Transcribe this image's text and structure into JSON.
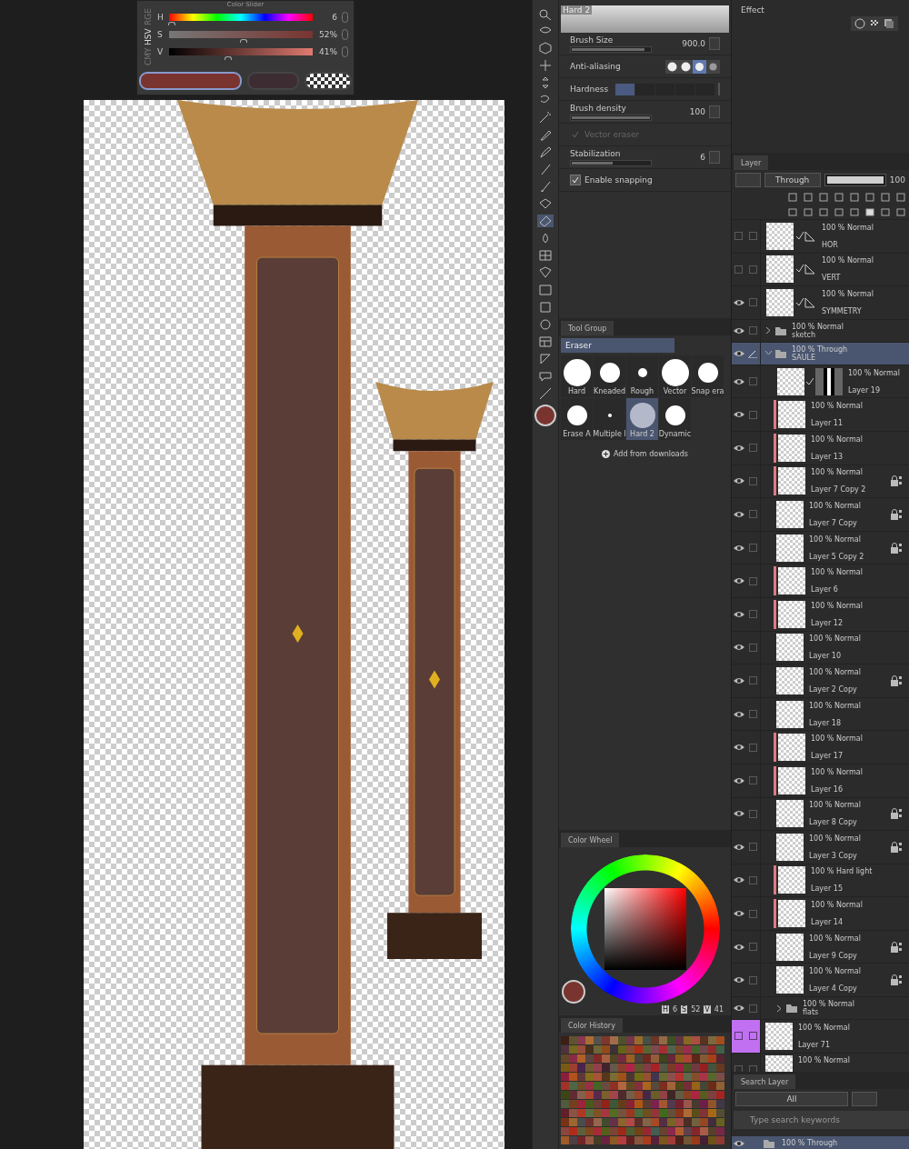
{
  "color_slider": {
    "title": "Color Slider",
    "modes": [
      {
        "label": "RGE",
        "selected": false
      },
      {
        "label": "HSV",
        "selected": true
      },
      {
        "label": "CMY",
        "selected": false
      }
    ],
    "channels": [
      {
        "label": "H",
        "kind": "hue",
        "level": 0.02,
        "reading": "6"
      },
      {
        "label": "S",
        "kind": "saturation",
        "level": 0.52,
        "reading": "52%"
      },
      {
        "label": "V",
        "kind": "value",
        "level": 0.41,
        "reading": "41%"
      }
    ],
    "swatches": [
      {
        "kind": "main",
        "color": "#7a3430",
        "selected": true
      },
      {
        "kind": "sub",
        "color": "#3e2c33",
        "selected": false
      },
      {
        "kind": "transparent",
        "selected": false
      }
    ]
  },
  "tool_settings": {
    "preset": "Hard 2",
    "rows": [
      {
        "kind": "slider",
        "label": "Brush Size",
        "level": 0.93,
        "reading": "900.0"
      },
      {
        "kind": "options",
        "label": "Anti-aliasing",
        "options": [
          {
            "selected": false
          },
          {
            "selected": false
          },
          {
            "selected": true
          },
          {
            "selected": false
          }
        ]
      },
      {
        "kind": "segments",
        "label": "Hardness",
        "level": 0.2
      },
      {
        "kind": "slider",
        "label": "Brush density",
        "level": 1,
        "reading": "100"
      },
      {
        "kind": "check",
        "label": "Vector eraser",
        "checked": true,
        "disabled": true
      },
      {
        "kind": "slider",
        "label": "Stabilization",
        "level": 0.52,
        "reading": "6"
      },
      {
        "kind": "check",
        "label": "Enable snapping",
        "checked": true,
        "disabled": false
      }
    ]
  },
  "tool_group": {
    "tab": "Tool Group",
    "group": "Eraser",
    "subtools": [
      {
        "label": "Hard",
        "kind": "large",
        "selected": false
      },
      {
        "label": "Kneaded",
        "kind": "textured",
        "selected": false
      },
      {
        "label": "Rough",
        "kind": "small",
        "selected": false
      },
      {
        "label": "Vector",
        "kind": "large",
        "selected": false
      },
      {
        "label": "Snap era",
        "kind": "medium",
        "selected": false
      },
      {
        "label": "Erase A",
        "kind": "medium",
        "selected": false
      },
      {
        "label": "Multiple l",
        "kind": "tiny",
        "selected": false
      },
      {
        "label": "Hard 2",
        "kind": "soft",
        "selected": true
      },
      {
        "label": "Dynamic",
        "kind": "medium",
        "selected": false
      }
    ],
    "add_button": "Add from downloads"
  },
  "color_wheel": {
    "tab": "Color Wheel",
    "readings": [
      {
        "label": "H",
        "value": "6"
      },
      {
        "label": "S",
        "value": "52"
      },
      {
        "label": "V",
        "value": "41"
      }
    ]
  },
  "color_history": {
    "tab": "Color History"
  },
  "effect": {
    "label": "Effect"
  },
  "layer_panel": {
    "tab": "Layer",
    "blend_mode": "Through",
    "opacity": {
      "level": 1,
      "reading": "100"
    },
    "layers": [
      {
        "kind": "ruler",
        "mode": "100 % Normal",
        "name": "HOR",
        "visible": false,
        "selected": false
      },
      {
        "kind": "ruler",
        "mode": "100 % Normal",
        "name": "VERT",
        "visible": false,
        "selected": false
      },
      {
        "kind": "ruler",
        "mode": "100 % Normal",
        "name": "SYMMETRY",
        "visible": true,
        "selected": false
      },
      {
        "kind": "folder",
        "mode": "100 % Normal",
        "name": "sketch",
        "visible": true,
        "selected": false,
        "expanded": false
      },
      {
        "kind": "folder",
        "mode": "100 % Through",
        "name": "SAULE",
        "visible": true,
        "selected": true,
        "expanded": true,
        "editing": true,
        "children": [
          {
            "kind": "mask",
            "mode": "100 % Normal",
            "name": "Layer 19",
            "visible": true,
            "selected": false
          },
          {
            "kind": "layer",
            "mode": "100 % Normal",
            "name": "Layer 11",
            "visible": true,
            "selected": false,
            "color": "#e07a80",
            "locked": false
          },
          {
            "kind": "layer",
            "mode": "100 % Normal",
            "name": "Layer 13",
            "visible": true,
            "selected": false,
            "color": "#e07a80",
            "locked": false
          },
          {
            "kind": "layer",
            "mode": "100 % Normal",
            "name": "Layer 7 Copy 2",
            "visible": true,
            "selected": false,
            "color": "#e07a80",
            "locked": true
          },
          {
            "kind": "layer",
            "mode": "100 % Normal",
            "name": "Layer 7 Copy",
            "visible": true,
            "selected": false,
            "locked": true
          },
          {
            "kind": "layer",
            "mode": "100 % Normal",
            "name": "Layer 5 Copy 2",
            "visible": true,
            "selected": false,
            "locked": true
          },
          {
            "kind": "layer",
            "mode": "100 % Normal",
            "name": "Layer 6",
            "visible": true,
            "selected": false,
            "color": "#e07a80",
            "locked": false
          },
          {
            "kind": "layer",
            "mode": "100 % Normal",
            "name": "Layer 12",
            "visible": true,
            "selected": false,
            "color": "#e07a80",
            "locked": false
          },
          {
            "kind": "layer",
            "mode": "100 % Normal",
            "name": "Layer 10",
            "visible": true,
            "selected": false,
            "locked": false
          },
          {
            "kind": "layer",
            "mode": "100 % Normal",
            "name": "Layer 2 Copy",
            "visible": true,
            "selected": false,
            "locked": true
          },
          {
            "kind": "layer",
            "mode": "100 % Normal",
            "name": "Layer 18",
            "visible": true,
            "selected": false,
            "locked": false
          },
          {
            "kind": "layer",
            "mode": "100 % Normal",
            "name": "Layer 17",
            "visible": true,
            "selected": false,
            "color": "#e07a80",
            "locked": false
          },
          {
            "kind": "layer",
            "mode": "100 % Normal",
            "name": "Layer 16",
            "visible": true,
            "selected": false,
            "color": "#e07a80",
            "locked": false
          },
          {
            "kind": "layer",
            "mode": "100 % Normal",
            "name": "Layer 8 Copy",
            "visible": true,
            "selected": false,
            "locked": true
          },
          {
            "kind": "layer",
            "mode": "100 % Normal",
            "name": "Layer 3 Copy",
            "visible": true,
            "selected": false,
            "locked": true
          },
          {
            "kind": "layer",
            "mode": "100 % Hard light",
            "name": "Layer 15",
            "visible": true,
            "selected": false,
            "color": "#e07a80",
            "locked": false
          },
          {
            "kind": "layer",
            "mode": "100 % Normal",
            "name": "Layer 14",
            "visible": true,
            "selected": false,
            "color": "#e07a80",
            "locked": false
          },
          {
            "kind": "layer",
            "mode": "100 % Normal",
            "name": "Layer 9 Copy",
            "visible": true,
            "selected": false,
            "locked": true
          },
          {
            "kind": "layer",
            "mode": "100 % Normal",
            "name": "Layer 4 Copy",
            "visible": true,
            "selected": false,
            "locked": true
          },
          {
            "kind": "folder",
            "mode": "100 % Normal",
            "name": "flats",
            "visible": true,
            "selected": false,
            "expanded": false
          }
        ]
      },
      {
        "kind": "layer",
        "mode": "100 % Normal",
        "name": "Layer 71",
        "visible": false,
        "selected": false,
        "locked": false,
        "marked": true
      },
      {
        "kind": "layer",
        "mode": "100 % Normal",
        "visible": false,
        "selected": false,
        "locked": false,
        "marked": false
      }
    ]
  },
  "search_layer": {
    "tab": "Search Layer",
    "filter": "All",
    "placeholder": "Type search keywords",
    "result": {
      "kind": "folder",
      "mode": "100 % Through",
      "visible": true,
      "selected": true
    }
  }
}
